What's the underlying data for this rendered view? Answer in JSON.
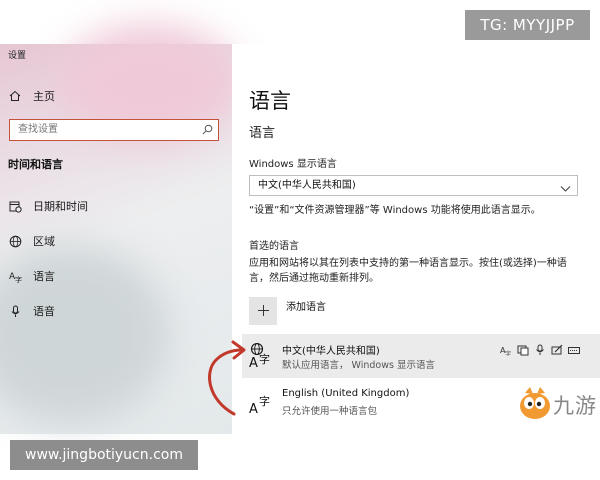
{
  "watermarks": {
    "top_right": "TG: MYYJJPP",
    "bottom_left": "www.jingbotiyucn.com",
    "logo_text": "九游"
  },
  "sidebar": {
    "window_title": "设置",
    "home_label": "主页",
    "search_placeholder": "查找设置",
    "section_heading": "时间和语言",
    "items": [
      {
        "label": "日期和时间",
        "icon": "calendar-clock-icon"
      },
      {
        "label": "区域",
        "icon": "globe-icon"
      },
      {
        "label": "语言",
        "icon": "language-icon"
      },
      {
        "label": "语音",
        "icon": "microphone-icon"
      }
    ]
  },
  "main": {
    "title": "语言",
    "subtitle": "语言",
    "display_language_label": "Windows 显示语言",
    "display_language_value": "中文(中华人民共和国)",
    "display_language_note": "“设置”和“文件资源管理器”等 Windows 功能将使用此语言显示。",
    "preferred_heading": "首选的语言",
    "preferred_desc_line1": "应用和网站将以其在列表中支持的第一种语言显示。按住(或选择)一种语",
    "preferred_desc_line2": "言，然后通过拖动重新排列。",
    "add_language_label": "添加语言",
    "languages": [
      {
        "name": "中文(中华人民共和国)",
        "desc": "默认应用语言， Windows 显示语言"
      },
      {
        "name": "English (United Kingdom)",
        "desc": "只允许使用一种语言包"
      }
    ]
  },
  "colors": {
    "search_border": "#c4523a",
    "arrow": "#c0392b",
    "selected_row": "#ebebeb"
  }
}
